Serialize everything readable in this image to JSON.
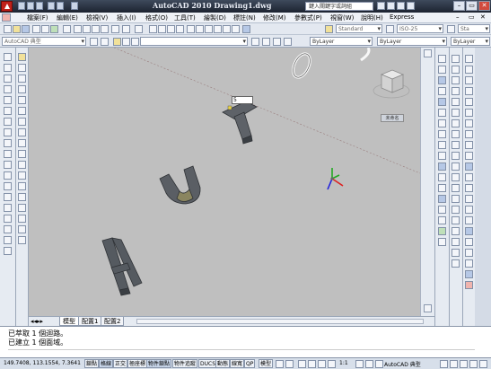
{
  "titlebar": {
    "title": "AutoCAD 2010    Drawing1.dwg",
    "search_placeholder": "鍵入關鍵字或詞組",
    "minimize": "–",
    "restore": "▭",
    "close": "✕"
  },
  "menubar": {
    "items": [
      "檔案(F)",
      "編輯(E)",
      "檢視(V)",
      "插入(I)",
      "格式(O)",
      "工具(T)",
      "繪製(D)",
      "標註(N)",
      "修改(M)",
      "參數式(P)",
      "視窗(W)",
      "說明(H)",
      "Express"
    ],
    "controls": [
      "–",
      "▭",
      "✕"
    ]
  },
  "toolbar": {
    "text_style": "Standard",
    "dim_style": "ISO-25",
    "right_combo": "Sta"
  },
  "workspace_combo": "AutoCAD 典型",
  "properties": {
    "color": "ByLayer",
    "linetype": "ByLayer",
    "lineweight": "ByLayer"
  },
  "viewport": {
    "tooltip_value": "5",
    "viewcube_label": "未命名",
    "bg_color": "#bfbfbf"
  },
  "tabs": [
    "模型",
    "配置1",
    "配置2"
  ],
  "command_lines": [
    "已萃取 1 個迴路。",
    "已建立 1 個面域。"
  ],
  "status": {
    "coordinates": "149.7408, 113.1554, 7.3641",
    "toggles": [
      "鎖點",
      "格線",
      "正交",
      "極座標",
      "物件鎖點",
      "物件追蹤",
      "DUCS",
      "動態",
      "線寬",
      "QP"
    ],
    "active_toggles": [
      1,
      4
    ],
    "model_label": "模型",
    "scale": "1:1",
    "workspace": "AutoCAD 典型"
  },
  "colors": {
    "titlebar": "#1c2330",
    "toolbar_bg": "#e3e8f0",
    "viewport_bg": "#bfbfbf",
    "letter_3d": "#55595e",
    "ucs_x": "#d22",
    "ucs_y": "#2a2",
    "ucs_z": "#22d"
  }
}
